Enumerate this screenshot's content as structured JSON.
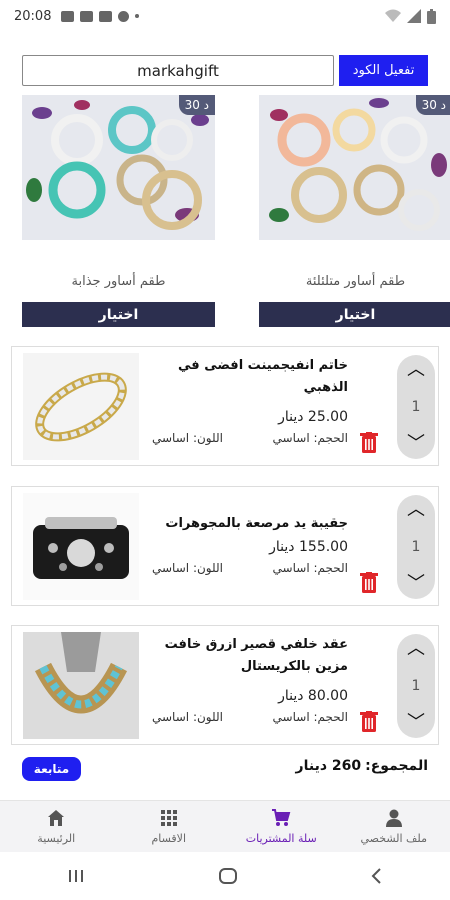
{
  "status_bar": {
    "time": "20:08"
  },
  "coupon": {
    "value": "markahgift",
    "activate_label": "تفعيل الكود"
  },
  "products": [
    {
      "name": "طقم أساور جذابة",
      "price_badge": "30 د",
      "choose_label": "اختيار"
    },
    {
      "name": "طقم أساور متلئلئة",
      "price_badge": "30 د",
      "choose_label": "اختيار"
    }
  ],
  "cart": [
    {
      "title": "خاتم انفيجمينت افضى في الذهبي",
      "price": "25.00",
      "currency": "دينار",
      "size_label": "الحجم:",
      "size": "اساسي",
      "color_label": "اللون:",
      "color": "اساسي",
      "qty": "1"
    },
    {
      "title": "جقيبة يد مرصعة بالمجوهرات",
      "price": "155.00",
      "currency": "دينار",
      "size_label": "الحجم:",
      "size": "اساسي",
      "color_label": "اللون:",
      "color": "اساسي",
      "qty": "1"
    },
    {
      "title": "عقد خلفي قصير ازرق خافت مزين بالكريستال",
      "price": "80.00",
      "currency": "دينار",
      "size_label": "الحجم:",
      "size": "اساسي",
      "color_label": "اللون:",
      "color": "اساسي",
      "qty": "1"
    }
  ],
  "summary": {
    "total_label": "المجموع:",
    "total_value": "260 دينار",
    "continue_label": "متابعة"
  },
  "bottom_nav": [
    {
      "label": "ملف الشخصي",
      "icon": "person-icon"
    },
    {
      "label": "سلة المشتريات",
      "icon": "cart-icon",
      "active": true
    },
    {
      "label": "الاقسام",
      "icon": "grid-icon"
    },
    {
      "label": "الرئيسية",
      "icon": "home-icon"
    }
  ],
  "colors": {
    "accent_blue": "#1f1ff0",
    "navy_button": "#2c2f4f",
    "active_nav": "#6a1fb5",
    "trash_red": "#e0262a"
  }
}
